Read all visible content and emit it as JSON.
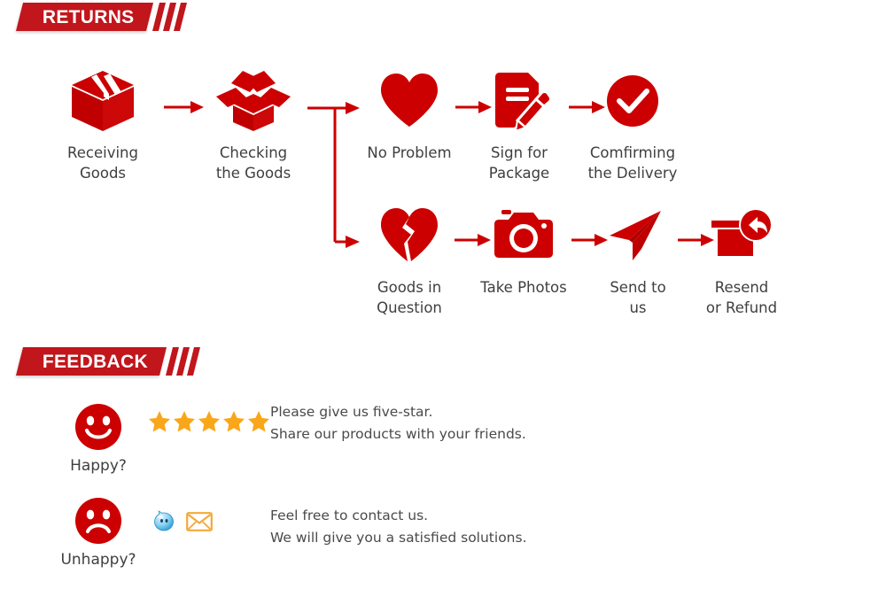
{
  "page": {
    "background": "#ffffff",
    "brand_red": "#c1161c",
    "icon_red": "#cc0000",
    "star_color": "#faa61a",
    "text_color": "#3f3f3f"
  },
  "sections": {
    "returns": {
      "banner_title": "RETURNS",
      "flow_row_top": [
        {
          "icon": "closed-box-icon",
          "label": "Receiving\nGoods"
        },
        {
          "icon": "open-box-icon",
          "label": "Checking\nthe Goods"
        },
        {
          "icon": "heart-icon",
          "label": "No Problem"
        },
        {
          "icon": "sign-document-pencil-icon",
          "label": "Sign for\nPackage"
        },
        {
          "icon": "check-circle-icon",
          "label": "Comfirming\nthe Delivery"
        }
      ],
      "flow_row_bottom": [
        {
          "icon": "broken-heart-icon",
          "label": "Goods in\nQuestion"
        },
        {
          "icon": "camera-icon",
          "label": "Take Photos"
        },
        {
          "icon": "paper-plane-icon",
          "label": "Send to\nus"
        },
        {
          "icon": "box-return-arrow-icon",
          "label": "Resend\nor Refund"
        }
      ]
    },
    "feedback": {
      "banner_title": "FEEDBACK",
      "rows": [
        {
          "face_icon": "happy-face-icon",
          "face_label": "Happy?",
          "rating_icon": "star-icon",
          "rating_count": 5,
          "message": "Please give us five-star.\nShare our products with your friends."
        },
        {
          "face_icon": "sad-face-icon",
          "face_label": "Unhappy?",
          "contact_icons": [
            "chat-bubble-icon",
            "envelope-icon"
          ],
          "message": "Feel free to contact us.\nWe will give you a satisfied solutions."
        }
      ]
    }
  }
}
